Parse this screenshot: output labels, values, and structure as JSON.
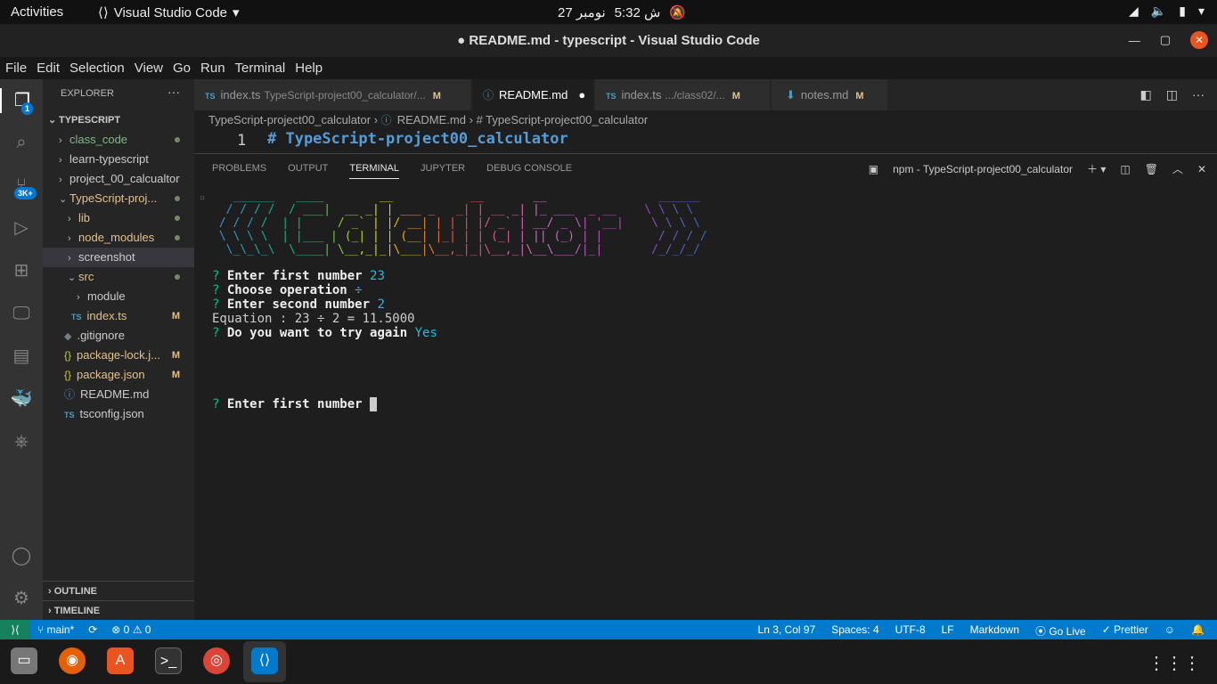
{
  "os": {
    "activities": "Activities",
    "app_name": "Visual Studio Code",
    "clock": "5:32 ش",
    "date": "27 نومبر"
  },
  "window": {
    "title": "● README.md - typescript - Visual Studio Code"
  },
  "menu": [
    "File",
    "Edit",
    "Selection",
    "View",
    "Go",
    "Run",
    "Terminal",
    "Help"
  ],
  "activity_badges": {
    "explorer": "1",
    "source_control": "3K+"
  },
  "explorer": {
    "header": "EXPLORER",
    "root": "TYPESCRIPT",
    "items": [
      {
        "label": "class_code"
      },
      {
        "label": "learn-typescript"
      },
      {
        "label": "project_00_calcualtor"
      },
      {
        "label": "TypeScript-proj..."
      },
      {
        "label": "lib"
      },
      {
        "label": "node_modules"
      },
      {
        "label": "screenshot"
      },
      {
        "label": "src"
      },
      {
        "label": "module"
      },
      {
        "label": "index.ts",
        "badge": "M"
      },
      {
        "label": ".gitignore"
      },
      {
        "label": "package-lock.j...",
        "badge": "M"
      },
      {
        "label": "package.json",
        "badge": "M"
      },
      {
        "label": "README.md"
      },
      {
        "label": "tsconfig.json"
      }
    ],
    "outline": "OUTLINE",
    "timeline": "TIMELINE"
  },
  "tabs": [
    {
      "label": "index.ts",
      "path": "TypeScript-project00_calculator/...",
      "mod": "M",
      "icon": "TS"
    },
    {
      "label": "README.md",
      "icon": "ⓘ"
    },
    {
      "label": "index.ts",
      "path": ".../class02/...",
      "mod": "M",
      "icon": "TS"
    },
    {
      "label": "notes.md",
      "mod": "M"
    }
  ],
  "breadcrumb": {
    "a": "TypeScript-project00_calculator",
    "b": "README.md",
    "c": "# TypeScript-project00_calculator"
  },
  "editor": {
    "line_number": "1",
    "line_text": "# TypeScript-project00_calculator"
  },
  "panel": {
    "tabs": [
      "PROBLEMS",
      "OUTPUT",
      "TERMINAL",
      "JUPYTER",
      "DEBUG CONSOLE"
    ],
    "terminal_name": "npm - TypeScript-project00_calculator"
  },
  "terminal": {
    "ascii_art": "   ______   ____        __           __       __                ______\n  / / / /  / ___|  __ _| | ___ _   _| | __ _| |_ ___  _ __    \\ \\ \\ \\\n / / / /  | |     / _` | |/ __| | | | |/ _` | __/ _ \\| '__|    \\ \\ \\ \\\n \\ \\ \\ \\  | |___ | (_| | | (__| |_| | | (_| | || (_) | |        / / / /\n  \\_\\_\\_\\  \\____| \\__,_|_|\\___|\\__,_|_|\\__,_|\\__\\___/|_|       /_/_/_/",
    "lines": [
      {
        "prompt": "?",
        "text": "Enter first number",
        "answer": "23"
      },
      {
        "prompt": "?",
        "text": "Choose operation",
        "answer": "÷"
      },
      {
        "prompt": "?",
        "text": "Enter second number",
        "answer": "2"
      },
      {
        "plain": "Equation : 23 ÷ 2 = 11.5000"
      },
      {
        "prompt": "?",
        "text": "Do you want to try again",
        "answer": "Yes"
      }
    ],
    "current_prompt": "?",
    "current_text": "Enter first number"
  },
  "status": {
    "branch": "main*",
    "errors": "⊗ 0 ⚠ 0",
    "position": "Ln 3, Col 97",
    "spaces": "Spaces: 4",
    "encoding": "UTF-8",
    "eol": "LF",
    "language": "Markdown",
    "golive": "Go Live",
    "prettier": "Prettier"
  }
}
